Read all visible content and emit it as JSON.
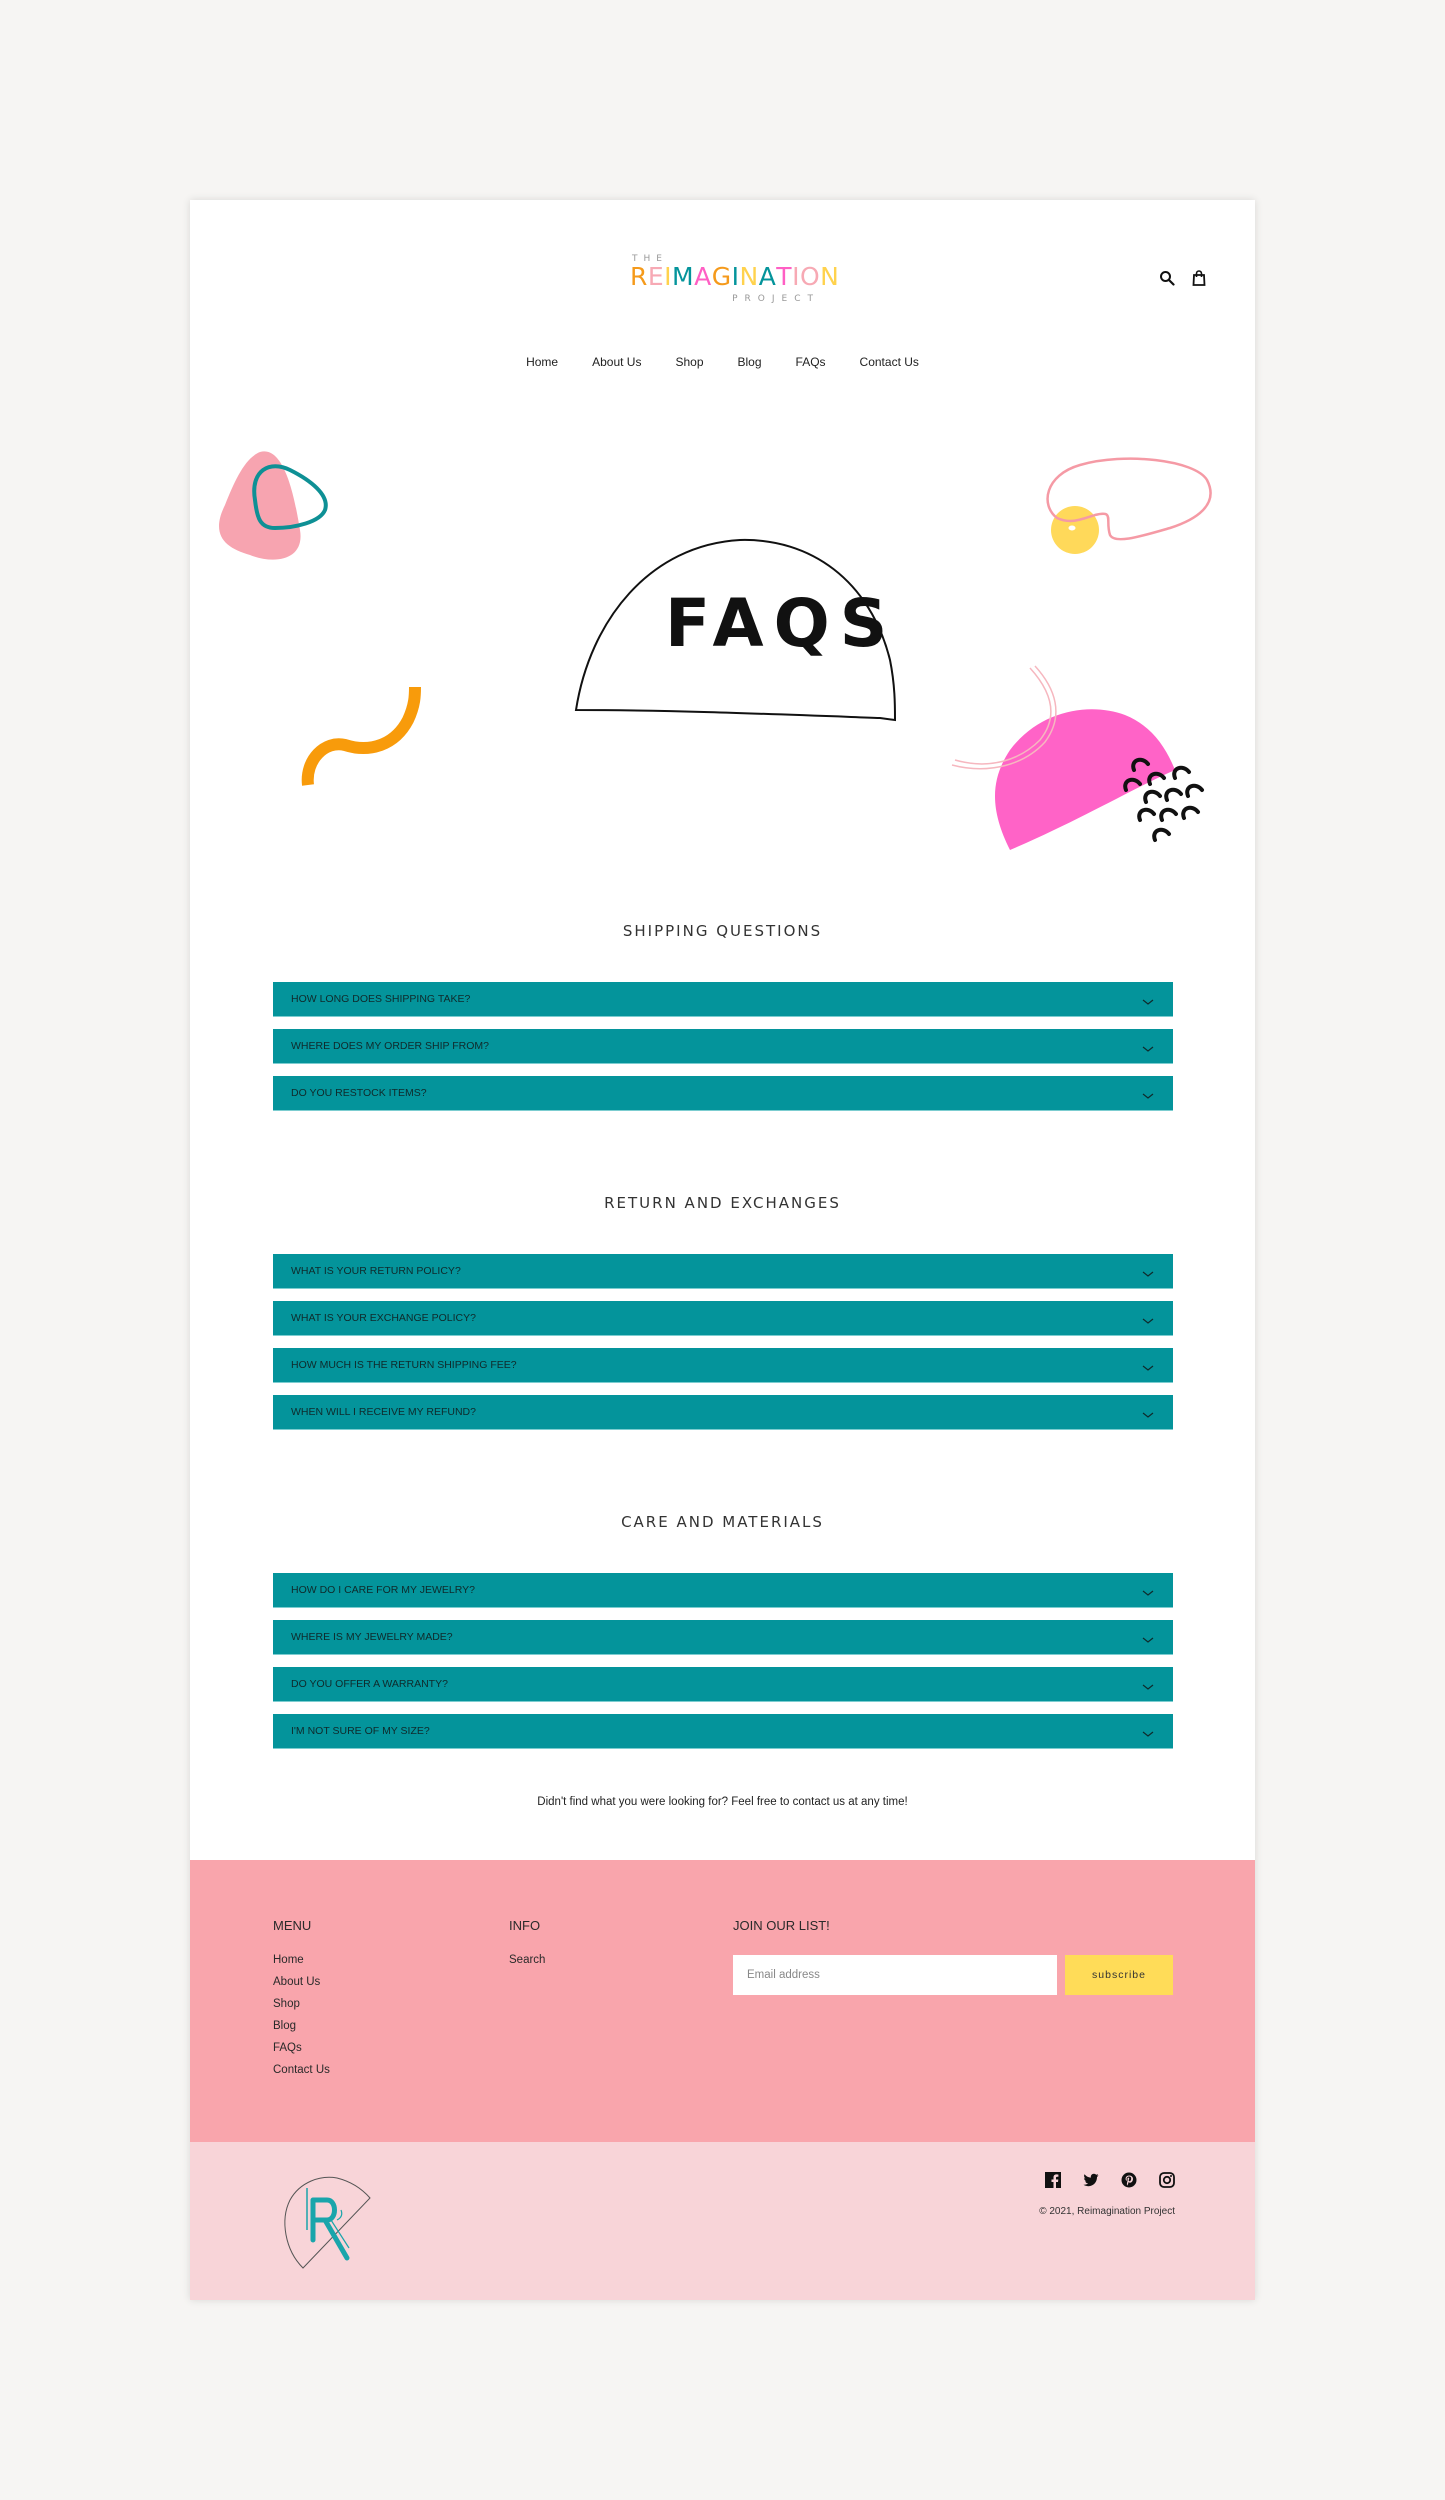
{
  "brand": {
    "logo_the": "THE",
    "logo_letters": [
      {
        "ch": "R",
        "color": "#f59a1b"
      },
      {
        "ch": "E",
        "color": "#f7a9b4"
      },
      {
        "ch": "I",
        "color": "#ffd24d"
      },
      {
        "ch": "M",
        "color": "#04949b"
      },
      {
        "ch": "A",
        "color": "#ff5fc4"
      },
      {
        "ch": "G",
        "color": "#f59a1b"
      },
      {
        "ch": "I",
        "color": "#04949b"
      },
      {
        "ch": "N",
        "color": "#ffd24d"
      },
      {
        "ch": "A",
        "color": "#04949b"
      },
      {
        "ch": "T",
        "color": "#ff5fc4"
      },
      {
        "ch": "I",
        "color": "#f7a9b4"
      },
      {
        "ch": "O",
        "color": "#f7a9b4"
      },
      {
        "ch": "N",
        "color": "#ffd24d"
      }
    ],
    "logo_project": "PROJECT"
  },
  "header": {
    "icons": [
      "search-icon",
      "cart-icon"
    ],
    "nav": [
      "Home",
      "About Us",
      "Shop",
      "Blog",
      "FAQs",
      "Contact Us"
    ]
  },
  "hero": {
    "title": "FAQS"
  },
  "sections": [
    {
      "title": "SHIPPING QUESTIONS",
      "questions": [
        "HOW LONG DOES SHIPPING TAKE?",
        "WHERE DOES MY ORDER SHIP FROM?",
        "DO YOU RESTOCK ITEMS?"
      ]
    },
    {
      "title": "RETURN AND EXCHANGES",
      "questions": [
        "WHAT IS YOUR RETURN POLICY?",
        "WHAT IS YOUR EXCHANGE POLICY?",
        "HOW MUCH IS THE RETURN SHIPPING FEE?",
        "WHEN WILL I RECEIVE MY REFUND?"
      ]
    },
    {
      "title": "CARE AND MATERIALS",
      "questions": [
        "HOW DO I CARE FOR MY JEWELRY?",
        "WHERE IS MY JEWELRY MADE?",
        "DO YOU OFFER A WARRANTY?",
        "I'M NOT SURE OF MY SIZE?"
      ]
    }
  ],
  "help_text": "Didn't find what you were looking for? Feel free to contact us at any time!",
  "footer": {
    "menu_title": "MENU",
    "menu_links": [
      "Home",
      "About Us",
      "Shop",
      "Blog",
      "FAQs",
      "Contact Us"
    ],
    "info_title": "INFO",
    "info_links": [
      "Search"
    ],
    "newsletter_title": "JOIN OUR LIST!",
    "email_placeholder": "Email address",
    "email_value": "",
    "subscribe_label": "subscribe",
    "socials": [
      "facebook-icon",
      "twitter-icon",
      "pinterest-icon",
      "instagram-icon"
    ],
    "copyright": "© 2021, Reimagination Project"
  },
  "colors": {
    "accent_teal": "#04949b",
    "footer_pink": "#f9a5ac",
    "subfooter_pink": "#f8d4d8",
    "subscribe_yellow": "#ffdc58",
    "page_bg": "#f6f5f3"
  }
}
